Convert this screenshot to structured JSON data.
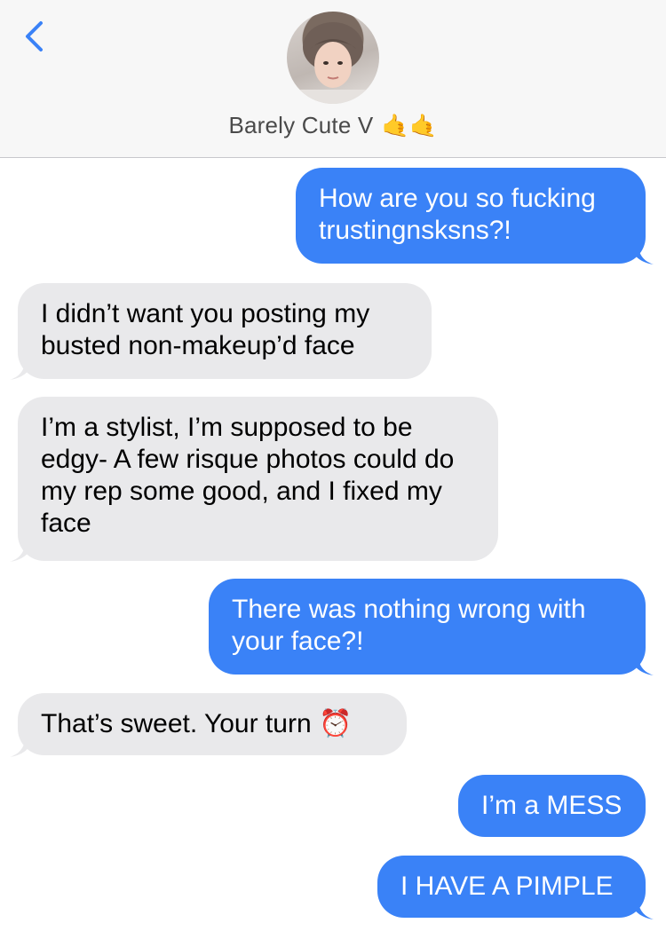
{
  "header": {
    "contact_name": "Barely Cute V",
    "contact_emoji": "🤙🤙"
  },
  "messages": [
    {
      "side": "sent",
      "text": "How are you so fucking trustingnsksns?!"
    },
    {
      "side": "received",
      "text": "I didn’t want you posting my busted non-makeup’d face"
    },
    {
      "side": "received",
      "text": "I’m a stylist, I’m supposed to be edgy- A few risque photos could do my rep some good, and I fixed my face"
    },
    {
      "side": "sent",
      "text": "There was nothing wrong with your face?!"
    },
    {
      "side": "received",
      "text": "That’s sweet. Your turn ⏰"
    },
    {
      "side": "sent",
      "text": "I’m a MESS"
    },
    {
      "side": "sent",
      "text": "I HAVE A PIMPLE"
    }
  ],
  "colors": {
    "sent_bubble": "#3a82f7",
    "received_bubble": "#e9e9eb",
    "header_bg": "#f7f7f7",
    "accent": "#3a82f7"
  },
  "icons": {
    "back": "chevron-left-icon",
    "avatar": "contact-avatar"
  }
}
